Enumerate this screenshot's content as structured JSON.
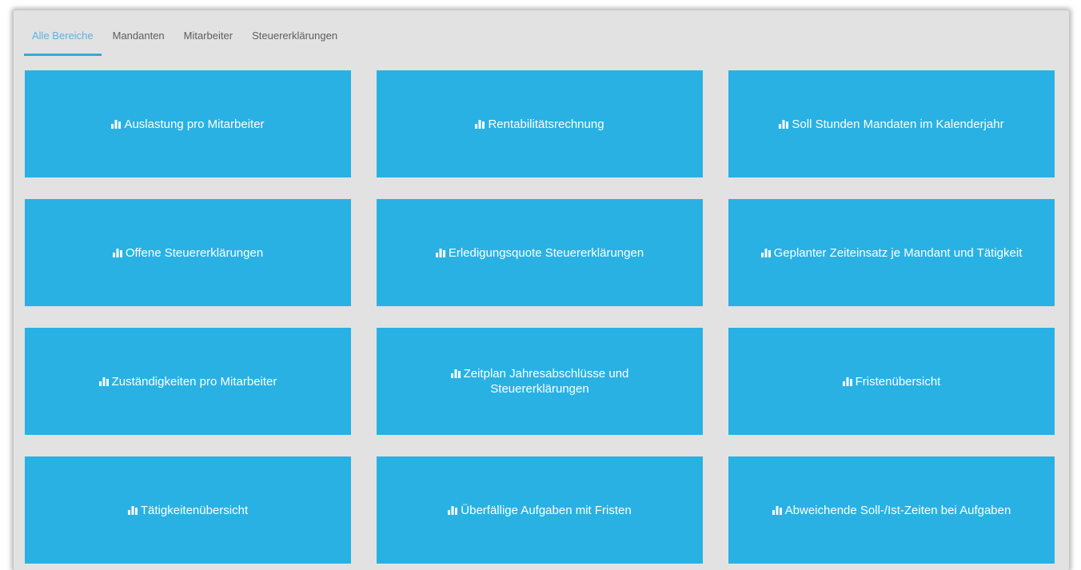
{
  "tabs": [
    {
      "label": "Alle Bereiche",
      "active": true
    },
    {
      "label": "Mandanten",
      "active": false
    },
    {
      "label": "Mitarbeiter",
      "active": false
    },
    {
      "label": "Steuererklärungen",
      "active": false
    }
  ],
  "tiles": [
    {
      "icon": "bar-chart-icon",
      "label": "Auslastung pro Mitarbeiter"
    },
    {
      "icon": "bar-chart-icon",
      "label": "Rentabilitätsrechnung"
    },
    {
      "icon": "bar-chart-icon",
      "label": "Soll Stunden Mandaten im Kalenderjahr"
    },
    {
      "icon": "bar-chart-icon",
      "label": "Offene Steuererklärungen"
    },
    {
      "icon": "bar-chart-icon",
      "label": "Erledigungsquote Steuererklärungen"
    },
    {
      "icon": "bar-chart-icon",
      "label": "Geplanter Zeiteinsatz je Mandant und Tätigkeit"
    },
    {
      "icon": "bar-chart-icon",
      "label": "Zuständigkeiten pro Mitarbeiter"
    },
    {
      "icon": "bar-chart-icon",
      "label": "Zeitplan Jahresabschlüsse und Steuererklärungen"
    },
    {
      "icon": "bar-chart-icon",
      "label": "Fristenübersicht"
    },
    {
      "icon": "bar-chart-icon",
      "label": "Tätigkeitenübersicht"
    },
    {
      "icon": "bar-chart-icon",
      "label": "Überfällige Aufgaben mit Fristen"
    },
    {
      "icon": "bar-chart-icon",
      "label": "Abweichende Soll-/Ist-Zeiten bei Aufgaben"
    }
  ],
  "colors": {
    "tile_background": "#29b1e4",
    "tile_text": "#ffffff",
    "tab_active": "#3aa7dc",
    "panel_background": "#e2e2e2"
  }
}
